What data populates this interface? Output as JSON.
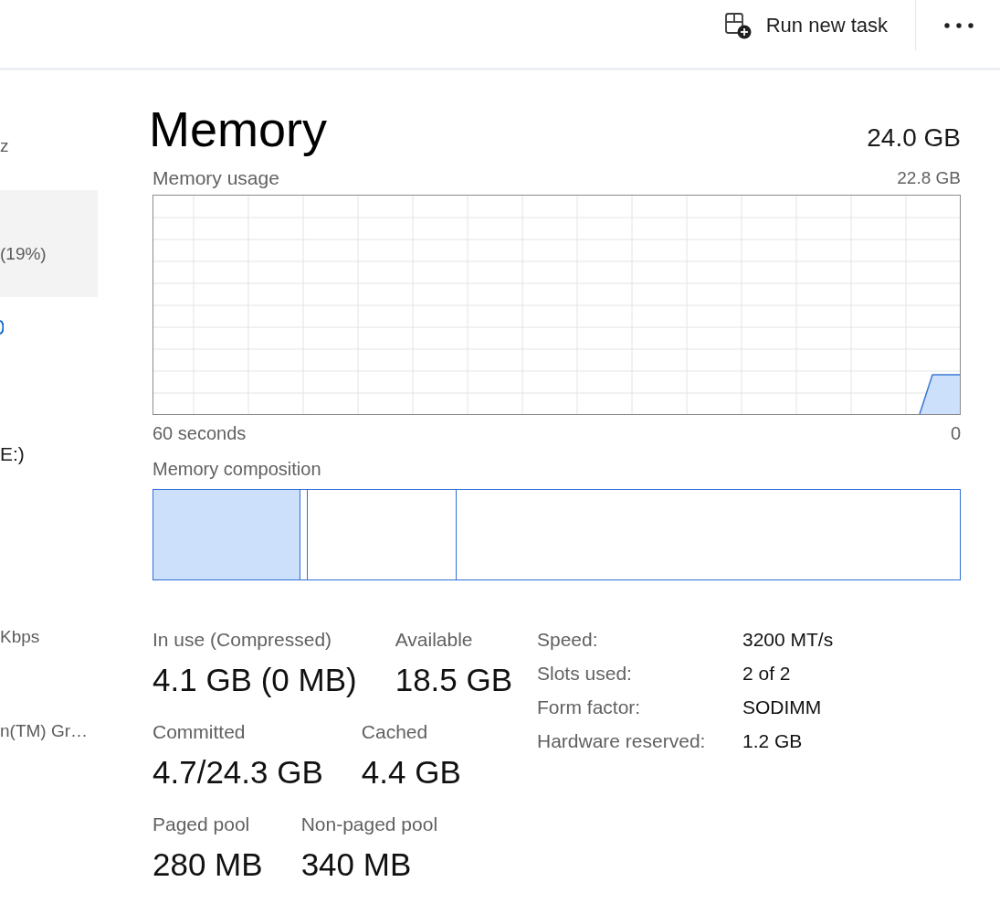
{
  "toolbar": {
    "buttons": [
      {
        "kind": "run_task",
        "label": "Run new task"
      },
      {
        "kind": "more"
      }
    ]
  },
  "sidebar": {
    "items": [
      {
        "kind": "subtitle",
        "text": "z",
        "selected": false
      },
      {
        "kind": "subtitle",
        "text": "(19%)",
        "selected": true
      },
      {
        "kind": "graph",
        "selected": false
      },
      {
        "kind": "title",
        "text": "E:)",
        "selected": false
      },
      {
        "kind": "subtitle",
        "text": "Kbps",
        "selected": false
      },
      {
        "kind": "subtitle",
        "text": "n(TM) Gr…",
        "selected": false
      }
    ]
  },
  "memory": {
    "title": "Memory",
    "total": "24.0 GB"
  },
  "usage_graph": {
    "label": "Memory usage",
    "max": "22.8 GB",
    "time_span": "60 seconds",
    "time_end": "0"
  },
  "composition": {
    "label": "Memory composition"
  },
  "stats": [
    [
      {
        "label": "In use (Compressed)",
        "value": "4.1 GB (0 MB)"
      },
      {
        "label": "Available",
        "value": "18.5 GB"
      }
    ],
    [
      {
        "label": "Committed",
        "value": "4.7/24.3 GB"
      },
      {
        "label": "Cached",
        "value": "4.4 GB"
      }
    ],
    [
      {
        "label": "Paged pool",
        "value": "280 MB"
      },
      {
        "label": "Non-paged pool",
        "value": "340 MB"
      }
    ]
  ],
  "details": [
    {
      "label": "Speed:",
      "value": "3200 MT/s"
    },
    {
      "label": "Slots used:",
      "value": "2 of 2"
    },
    {
      "label": "Form factor:",
      "value": "SODIMM"
    },
    {
      "label": "Hardware reserved:",
      "value": "1.2 GB"
    }
  ]
}
